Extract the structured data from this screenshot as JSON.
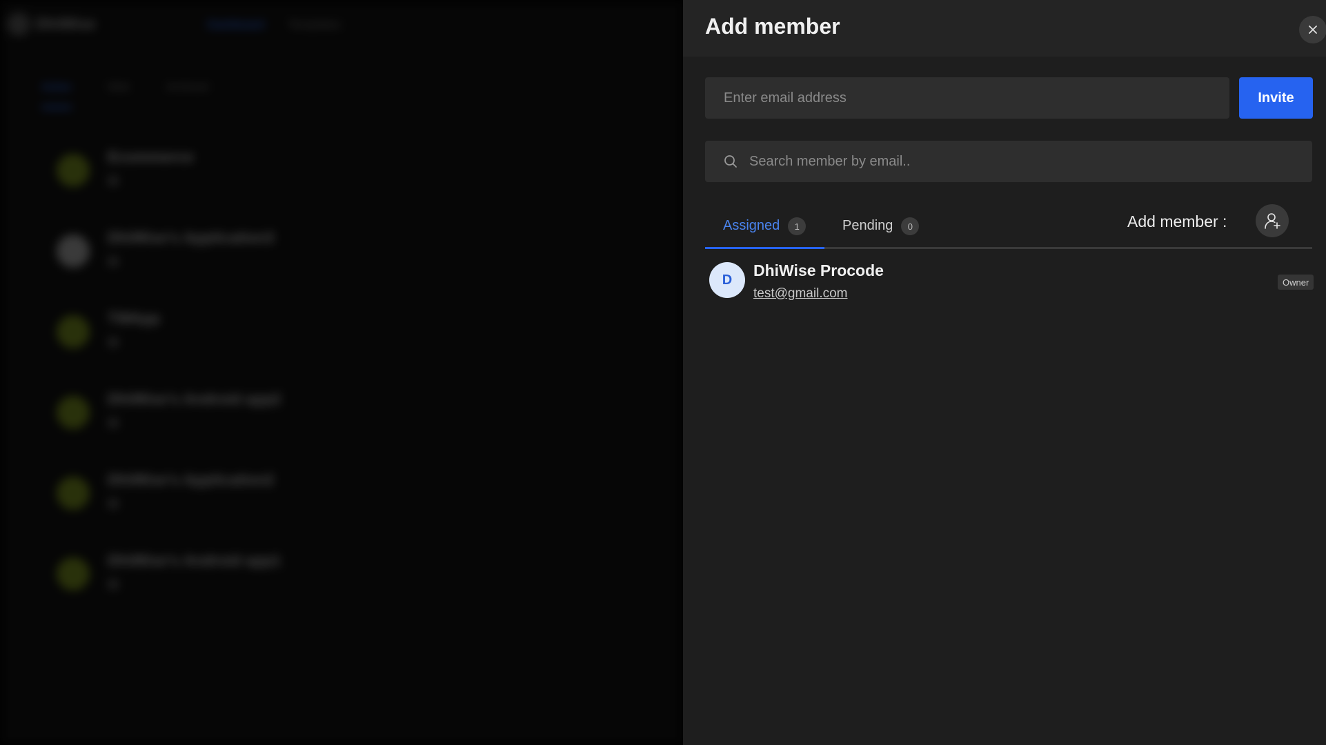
{
  "background_app": {
    "logo_text": "DhiWise",
    "nav": [
      "Dashboard",
      "Templates"
    ],
    "tabs": [
      "Active",
      "Web",
      "Archived"
    ],
    "items": [
      {
        "title": "Ecommerce"
      },
      {
        "title": "DhiWise's Application3"
      },
      {
        "title": "TWApp"
      },
      {
        "title": "DhiWise's Android app2"
      },
      {
        "title": "DhiWise's Application2"
      },
      {
        "title": "DhiWise's Android app1"
      }
    ]
  },
  "drawer": {
    "title": "Add member",
    "close_icon": "close-icon",
    "email_placeholder": "Enter email address",
    "invite_label": "Invite",
    "search_placeholder": "Search member by email..",
    "tabs": [
      {
        "label": "Assigned",
        "count": "1",
        "active": true
      },
      {
        "label": "Pending",
        "count": "0",
        "active": false
      }
    ],
    "add_member_label": "Add member :",
    "add_member_icon": "user-plus-icon",
    "members": [
      {
        "initial": "D",
        "name": "DhiWise Procode",
        "email": "test@gmail.com",
        "role": "Owner"
      }
    ]
  },
  "colors": {
    "accent": "#2663f0",
    "active_tab_text": "#4a84ef",
    "drawer_bg": "#1e1e1e",
    "input_bg": "#2e2e2e"
  }
}
